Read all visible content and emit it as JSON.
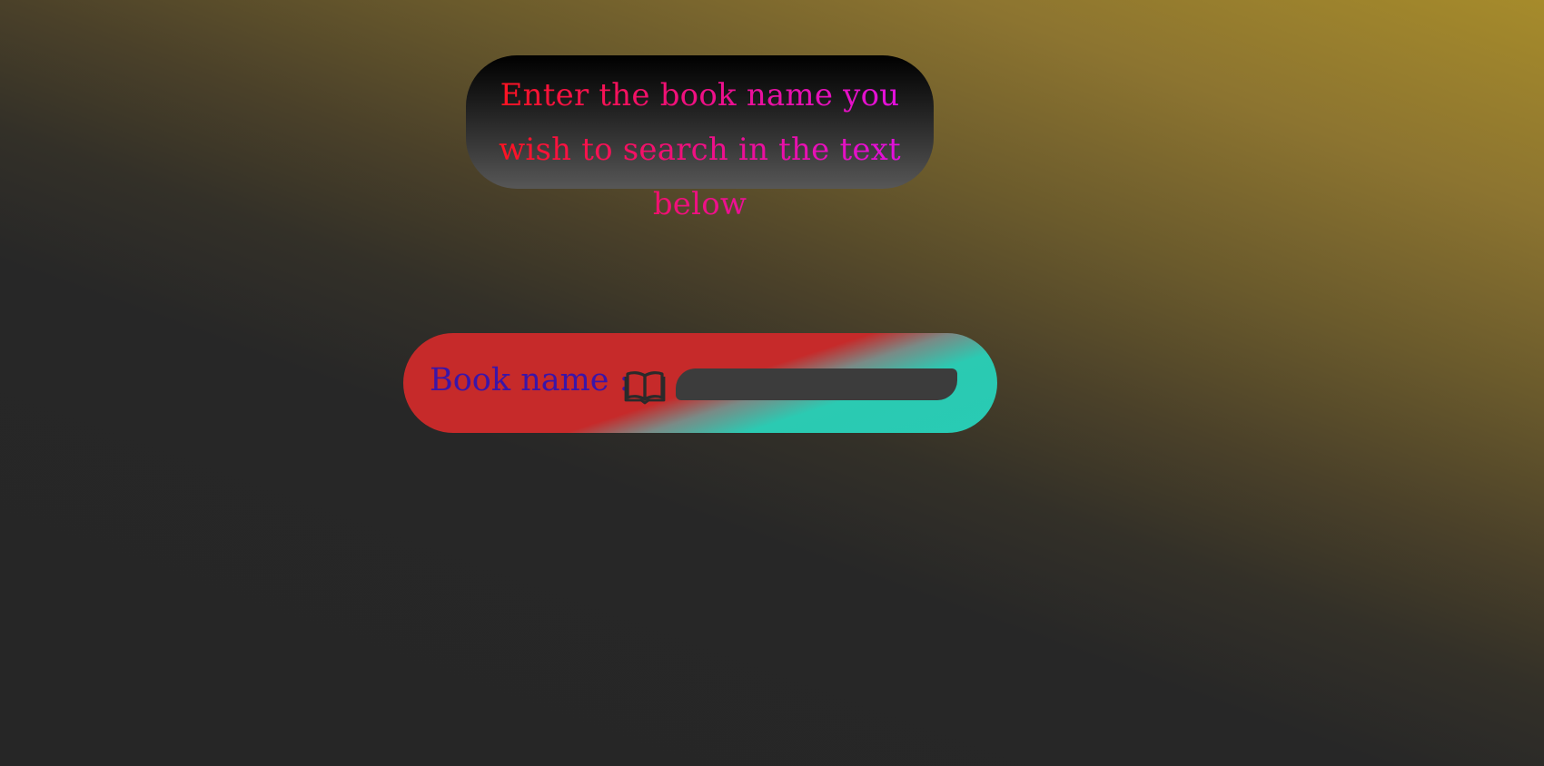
{
  "banner": {
    "text": "Enter the book name you wish to search in the text below"
  },
  "search": {
    "label": "Book name :",
    "value": "",
    "icon": "book-open-icon"
  },
  "colors": {
    "banner_text_start": "#ff1414",
    "banner_text_end": "#e010e8",
    "label_color": "#3b15a8",
    "pill_red": "#c62a2a",
    "pill_teal": "#28cbb4",
    "input_bg": "#3c3c3c"
  }
}
